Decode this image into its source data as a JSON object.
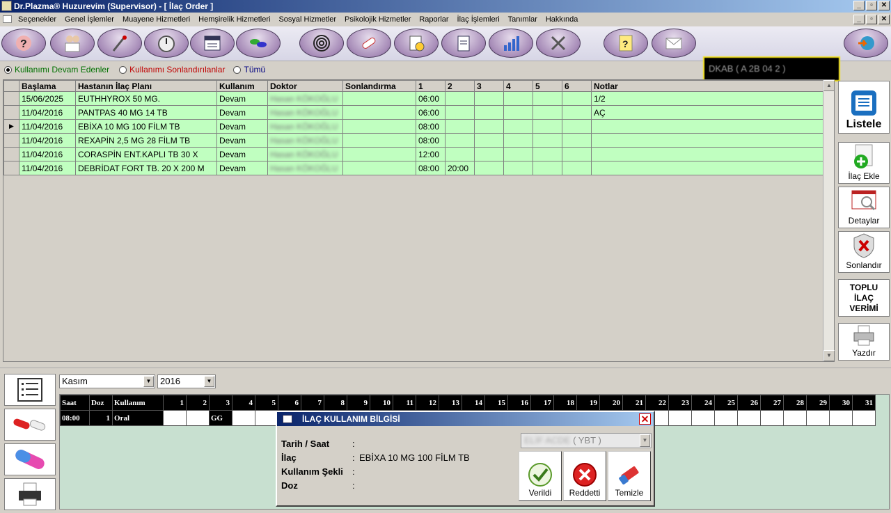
{
  "window": {
    "title": "Dr.Plazma® Huzurevim (Supervisor) - [ İlaç Order ]"
  },
  "menu": [
    "Seçenekler",
    "Genel İşlemler",
    "Muayene Hizmetleri",
    "Hemşirelik Hizmetleri",
    "Sosyal Hizmetler",
    "Psikolojik Hizmetler",
    "Raporlar",
    "İlaç İşlemleri",
    "Tanımlar",
    "Hakkında"
  ],
  "toolbar": {
    "icons": [
      "help-head-icon",
      "doctors-icon",
      "nursing-icon",
      "stopwatch-icon",
      "doc-icon",
      "pills-icon",
      "spiral-icon",
      "bandage-icon",
      "clipboard-clock-icon",
      "clipboard-icon",
      "chart-icon",
      "tools-icon",
      "note-help-icon",
      "mail-icon",
      "globe-icon"
    ],
    "user_box": "DKAB ( A 2B 04 2 )"
  },
  "filters": {
    "active": "Kullanımı Devam Edenler",
    "ended": "Kullanımı Sonlandırılanlar",
    "all": "Tümü"
  },
  "grid": {
    "headers": [
      "Başlama",
      "Hastanın İlaç Planı",
      "Kullanım",
      "Doktor",
      "Sonlandırma",
      "1",
      "2",
      "3",
      "4",
      "5",
      "6",
      "Notlar"
    ],
    "rows": [
      {
        "start": "15/06/2025",
        "plan": "EUTHHYROX  50 MG.",
        "usage": "Devam",
        "doctor": "Hasan KÖKOĞLU",
        "end": "",
        "t1": "06:00",
        "t2": "",
        "notes": "1/2"
      },
      {
        "start": "11/04/2016",
        "plan": "PANTPAS 40 MG 14 TB",
        "usage": "Devam",
        "doctor": "Hasan KÖKOĞLU",
        "end": "",
        "t1": "06:00",
        "t2": "",
        "notes": "AÇ"
      },
      {
        "start": "11/04/2016",
        "plan": "EBİXA 10 MG 100 FİLM TB",
        "usage": "Devam",
        "doctor": "Hasan KÖKOĞLU",
        "end": "",
        "t1": "08:00",
        "t2": "",
        "notes": ""
      },
      {
        "start": "11/04/2016",
        "plan": "REXAPİN 2,5 MG 28 FİLM TB",
        "usage": "Devam",
        "doctor": "Hasan KÖKOĞLU",
        "end": "",
        "t1": "08:00",
        "t2": "",
        "notes": ""
      },
      {
        "start": "11/04/2016",
        "plan": "CORASPİN  ENT.KAPLI TB  30  X",
        "usage": "Devam",
        "doctor": "Hasan KÖKOĞLU",
        "end": "",
        "t1": "12:00",
        "t2": "",
        "notes": ""
      },
      {
        "start": "11/04/2016",
        "plan": "DEBRİDAT FORT  TB.  20  X 200 M",
        "usage": "Devam",
        "doctor": "Hasan KÖKOĞLU",
        "end": "",
        "t1": "08:00",
        "t2": "20:00",
        "notes": ""
      }
    ]
  },
  "side_buttons": {
    "list": "Listele",
    "add": "İlaç Ekle",
    "details": "Detaylar",
    "end": "Sonlandır",
    "bulk": "TOPLU İLAÇ VERİMİ",
    "print": "Yazdır"
  },
  "calendar": {
    "month": "Kasım",
    "year": "2016",
    "headers": {
      "time": "Saat",
      "dose": "Doz",
      "usage": "Kullanım"
    },
    "days": [
      "1",
      "2",
      "3",
      "4",
      "5",
      "6",
      "7",
      "8",
      "9",
      "10",
      "11",
      "12",
      "13",
      "14",
      "15",
      "16",
      "17",
      "18",
      "19",
      "20",
      "21",
      "22",
      "23",
      "24",
      "25",
      "26",
      "27",
      "28",
      "29",
      "30",
      "31"
    ],
    "row": {
      "time": "08:00",
      "dose": "1",
      "usage": "Oral",
      "day3": "GG"
    }
  },
  "dialog": {
    "title": "İLAÇ KULLANIM BİLGİSİ",
    "labels": {
      "datetime": "Tarih / Saat",
      "drug": "İlaç",
      "form": "Kullanım Şekli",
      "dose": "Doz"
    },
    "colon": ":",
    "values": {
      "drug": "EBİXA 10 MG 100 FİLM TB"
    },
    "staff_select": "ELİF ACDE",
    "staff_suffix": " ( YBT )",
    "buttons": {
      "given": "Verildi",
      "rejected": "Reddetti",
      "clear": "Temizle"
    }
  }
}
